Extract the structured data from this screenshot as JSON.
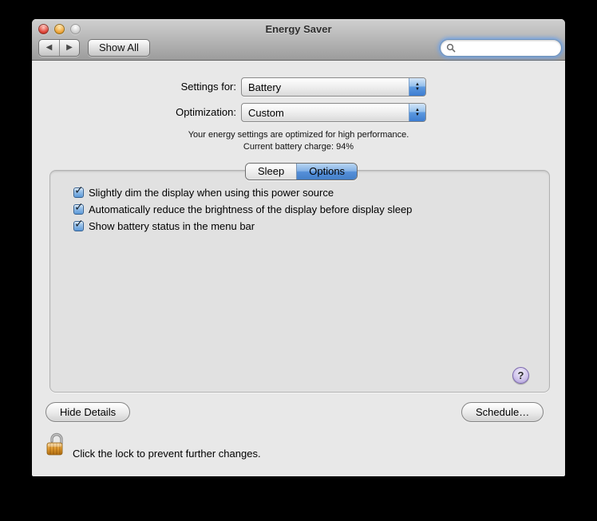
{
  "window": {
    "title": "Energy Saver"
  },
  "toolbar": {
    "show_all_label": "Show All",
    "search_value": ""
  },
  "glyphs": {
    "back": "◀",
    "forward": "▶",
    "up": "▲",
    "down": "▼",
    "check": "✓",
    "help": "?"
  },
  "settings": {
    "settings_for_label": "Settings for:",
    "settings_for_value": "Battery",
    "optimization_label": "Optimization:",
    "optimization_value": "Custom",
    "info_line1": "Your energy settings are optimized for high performance.",
    "info_line2": "Current battery charge: 94%"
  },
  "tabs": [
    {
      "label": "Sleep",
      "selected": false
    },
    {
      "label": "Options",
      "selected": true
    }
  ],
  "options_panel": {
    "checkboxes": [
      {
        "label": "Slightly dim the display when using this power source",
        "checked": true
      },
      {
        "label": "Automatically reduce the brightness of the display before display sleep",
        "checked": true
      },
      {
        "label": "Show battery status in the menu bar",
        "checked": true
      }
    ]
  },
  "footer": {
    "hide_details_label": "Hide Details",
    "schedule_label": "Schedule…",
    "lock_text": "Click the lock to prevent further changes."
  },
  "colors": {
    "selection_blue": "#447fc8",
    "window_bg": "#e8e8e8",
    "focus_ring": "#69a0eb",
    "lock_gold": "#e09a2f"
  }
}
